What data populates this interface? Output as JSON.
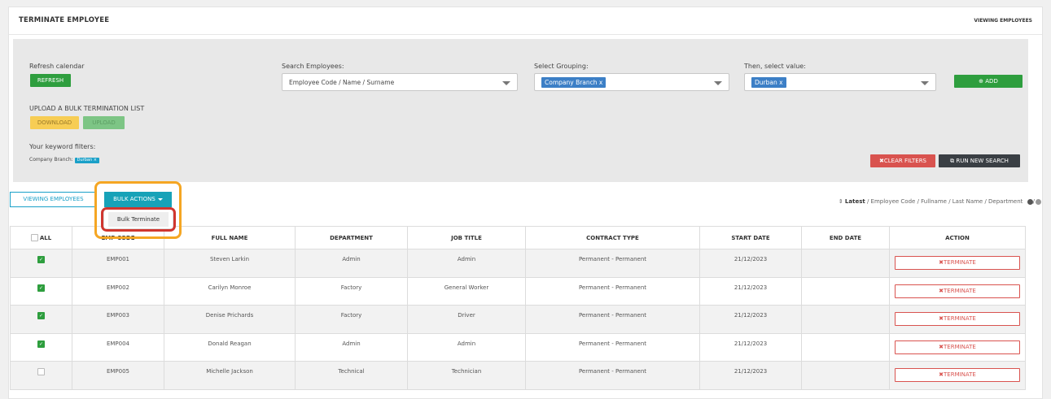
{
  "header": {
    "title": "TERMINATE EMPLOYEE",
    "right_label": "VIEWING EMPLOYEES"
  },
  "filters": {
    "refresh_label": "Refresh calendar",
    "refresh_button": "REFRESH",
    "search_label": "Search Employees:",
    "search_placeholder": "Employee Code / Name / Surname",
    "grouping_label": "Select Grouping:",
    "grouping_value": "Company Branch",
    "value_label": "Then, select value:",
    "value_value": "Durban",
    "chip_remove": "x",
    "add_button": "ADD",
    "bulk_list_label": "UPLOAD A BULK TERMINATION LIST",
    "download_button": "DOWNLOAD",
    "upload_button": "UPLOAD",
    "keyword_label": "Your keyword filters:",
    "keyword_filter_name": "Company Branch:",
    "keyword_filter_value": "Durban ×",
    "clear_button": "CLEAR FILTERS",
    "run_search_button": "RUN NEW SEARCH"
  },
  "toolbar": {
    "viewing_button": "VIEWING EMPLOYEES",
    "bulk_actions_button": "BULK ACTIONS",
    "bulk_menu_item": "Bulk Terminate",
    "sort_active": "Latest",
    "sort_options": " / Employee Code / Fullname / Last Name / Department"
  },
  "table": {
    "all_label": "ALL",
    "headers": [
      "EMP CODE",
      "FULL NAME",
      "DEPARTMENT",
      "JOB TITLE",
      "CONTRACT TYPE",
      "START DATE",
      "END DATE",
      "ACTION"
    ],
    "terminate_label": "TERMINATE",
    "rows": [
      {
        "checked": true,
        "code": "EMP001",
        "name": "Steven Larkin",
        "department": "Admin",
        "job": "Admin",
        "contract": "Permanent - Permanent",
        "start": "21/12/2023",
        "end": ""
      },
      {
        "checked": true,
        "code": "EMP002",
        "name": "Carilyn Monroe",
        "department": "Factory",
        "job": "General Worker",
        "contract": "Permanent - Permanent",
        "start": "21/12/2023",
        "end": ""
      },
      {
        "checked": true,
        "code": "EMP003",
        "name": "Denise Prichards",
        "department": "Factory",
        "job": "Driver",
        "contract": "Permanent - Permanent",
        "start": "21/12/2023",
        "end": ""
      },
      {
        "checked": true,
        "code": "EMP004",
        "name": "Donald Reagan",
        "department": "Admin",
        "job": "Admin",
        "contract": "Permanent - Permanent",
        "start": "21/12/2023",
        "end": ""
      },
      {
        "checked": false,
        "code": "EMP005",
        "name": "Michelle Jackson",
        "department": "Technical",
        "job": "Technician",
        "contract": "Permanent - Permanent",
        "start": "21/12/2023",
        "end": ""
      }
    ]
  },
  "colors": {
    "accent": "#17a2b8",
    "green": "#2e9e3e",
    "danger": "#d9534f",
    "highlight_orange": "#f5a623",
    "highlight_red": "#d0362f"
  },
  "icons": {
    "add": "plus-circle-icon",
    "clear": "times-icon",
    "run": "external-link-icon",
    "terminate": "times-icon",
    "sort": "sort-icon"
  }
}
